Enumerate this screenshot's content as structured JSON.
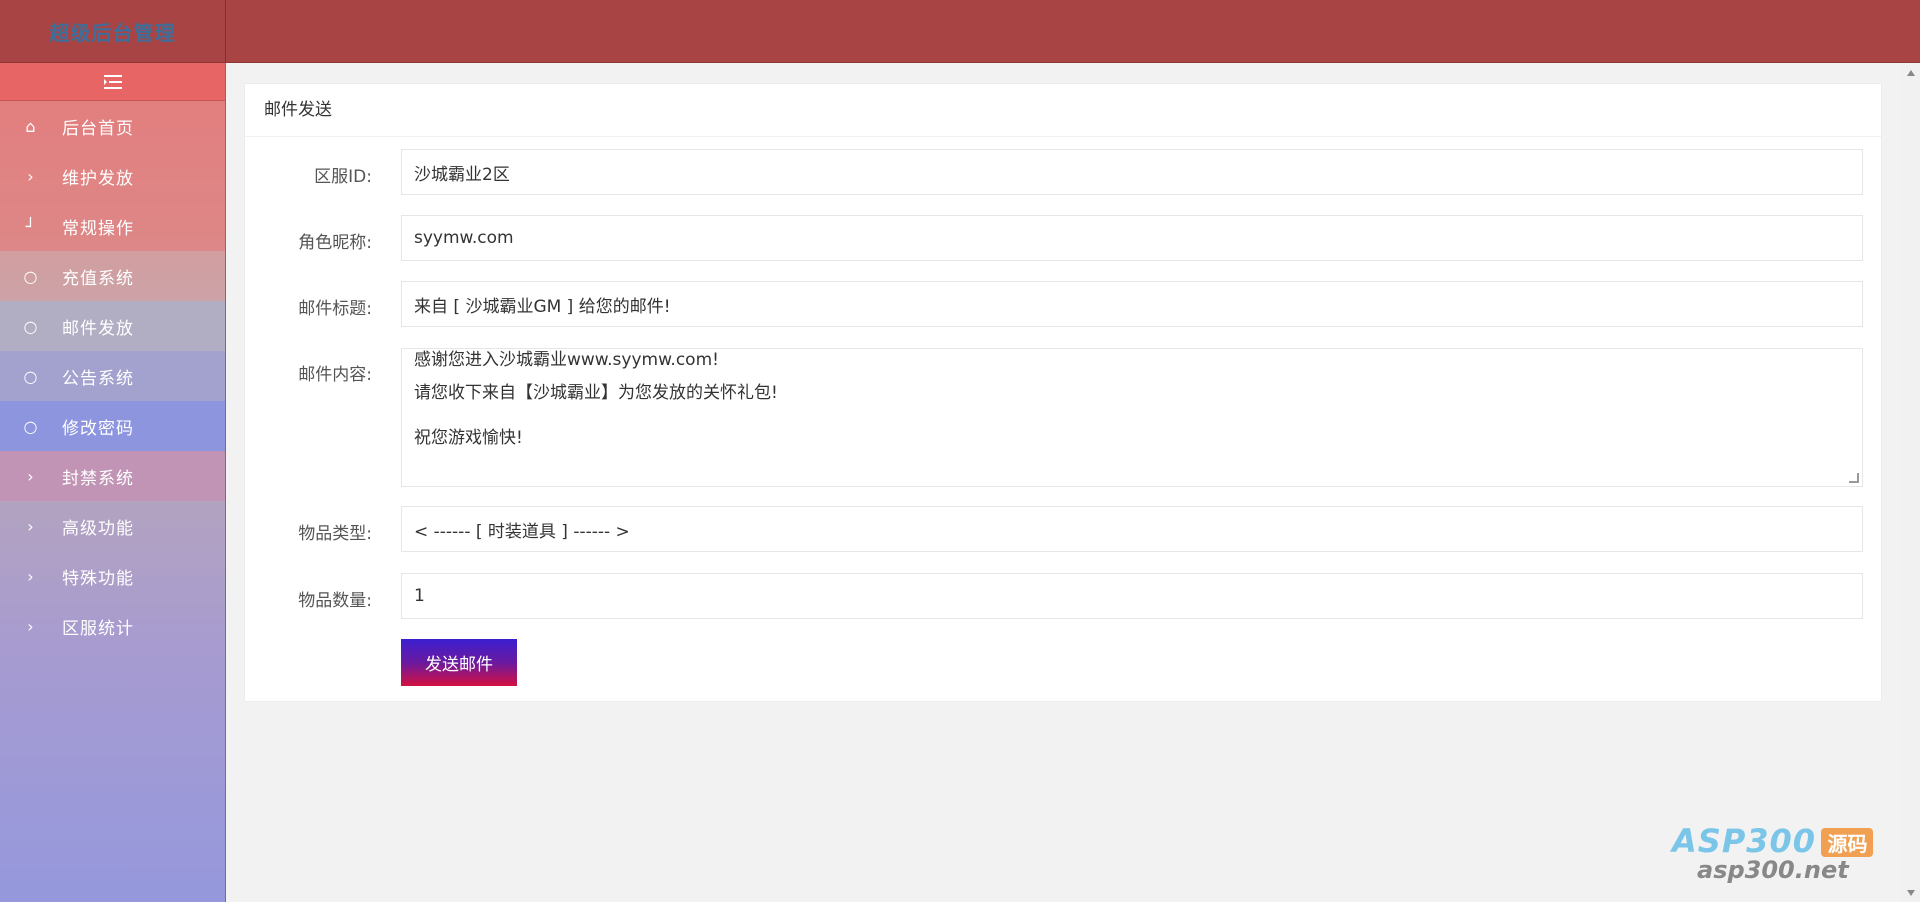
{
  "header": {
    "logo_text": "超级后台管理"
  },
  "sidebar": {
    "toggle_icon": "menu-fold-icon",
    "items": [
      {
        "label": "后台首页",
        "icon": "home-icon"
      },
      {
        "label": "维护发放",
        "icon": "chevron-right-icon"
      },
      {
        "label": "常规操作",
        "icon": "corner-icon"
      },
      {
        "label": "充值系统",
        "icon": "circle-icon"
      },
      {
        "label": "邮件发放",
        "icon": "circle-icon"
      },
      {
        "label": "公告系统",
        "icon": "circle-icon"
      },
      {
        "label": "修改密码",
        "icon": "circle-icon"
      },
      {
        "label": "封禁系统",
        "icon": "chevron-right-icon"
      },
      {
        "label": "高级功能",
        "icon": "chevron-right-icon"
      },
      {
        "label": "特殊功能",
        "icon": "chevron-right-icon"
      },
      {
        "label": "区服统计",
        "icon": "chevron-right-icon"
      }
    ]
  },
  "form": {
    "title": "邮件发送",
    "server_label": "区服ID:",
    "server_value": "沙城霸业2区",
    "role_label": "角色昵称:",
    "role_value": "syymw.com",
    "subject_label": "邮件标题:",
    "subject_value": "来自 [ 沙城霸业GM ] 给您的邮件!",
    "content_label": "邮件内容:",
    "content_lines": [
      "感谢您进入沙城霸业www.syymw.com!",
      "请您收下来自【沙城霸业】为您发放的关怀礼包!",
      "祝您游戏愉快!"
    ],
    "item_type_label": "物品类型:",
    "item_type_value": "< ------ [ 时装道具 ] ------ >",
    "item_count_label": "物品数量:",
    "item_count_value": "1",
    "submit_label": "发送邮件"
  },
  "watermark": {
    "brand": "ASP300",
    "badge": "源码",
    "url": "asp300.net"
  },
  "colors": {
    "header": "#a94444",
    "toggle": "#e86565",
    "button_top": "#3a1fd0",
    "button_bottom": "#d41040"
  }
}
